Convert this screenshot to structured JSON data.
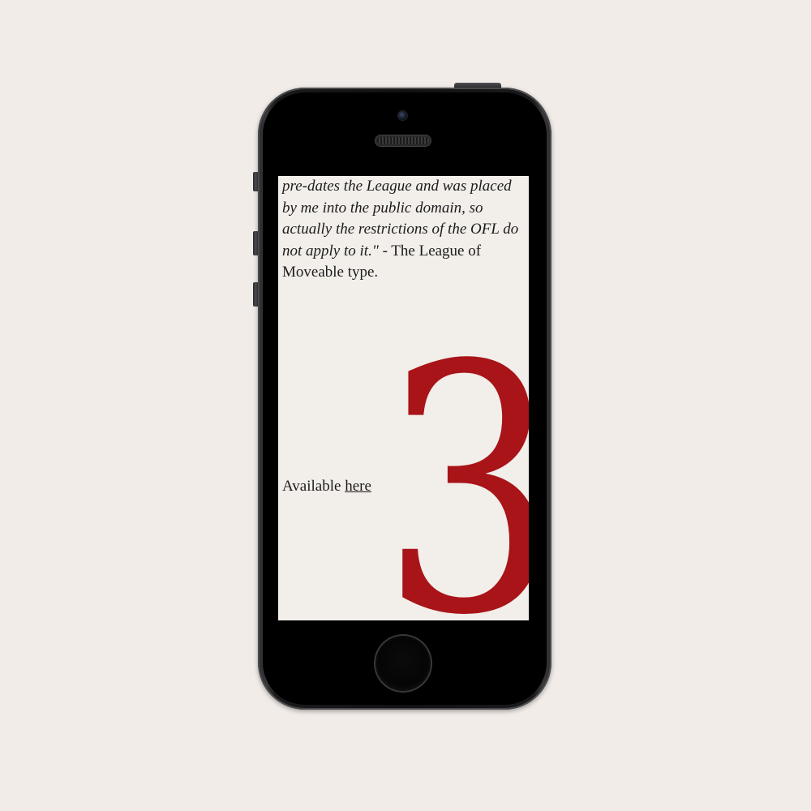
{
  "screen": {
    "quote_lines": [
      "pre-dates the League and was placed",
      "by me into the public domain, so",
      "actually the restrictions of the OFL do",
      "not apply to it.\""
    ],
    "attribution_suffix": " - The League of",
    "attribution_line2": "Moveable type.",
    "available_label": "Available ",
    "available_link": "here",
    "numeral": "3"
  },
  "colors": {
    "page_background": "#f1ece8",
    "screen_background": "#f2eeea",
    "numeral_red": "#a81418",
    "text": "#1c1c1c"
  }
}
